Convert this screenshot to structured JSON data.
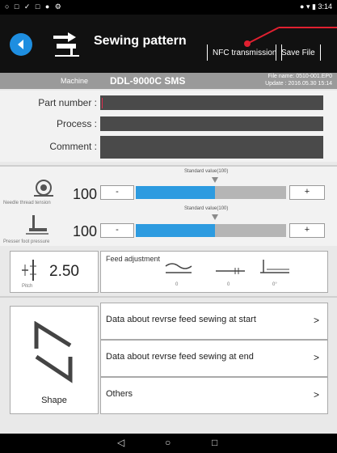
{
  "status_bar": {
    "icons_left": "○ □ ✓ □ ● ⚙",
    "time": "3:14"
  },
  "app_bar": {
    "title": "Sewing pattern",
    "nfc_label": "NFC transmission",
    "save_label": "Save File",
    "back_icon": "back-arrow-icon"
  },
  "machine_bar": {
    "label": "Machine",
    "name": "DDL-9000C SMS",
    "file_name": "File name: 0510-001.EP0",
    "update": "Update : 2016.05.30 15:14"
  },
  "form": {
    "part_number_label": "Part number :",
    "process_label": "Process :",
    "comment_label": "Comment :",
    "part_number_value": "",
    "process_value": "",
    "comment_value": ""
  },
  "needle_tension": {
    "caption": "Needle thread tension",
    "value": "100",
    "std_label": "Standard value(100)",
    "minus": "-",
    "plus": "+",
    "fill_fraction": 0.5
  },
  "presser_pressure": {
    "caption": "Presser foot pressure",
    "value": "100",
    "std_label": "Standard value(100)",
    "minus": "-",
    "plus": "+",
    "fill_fraction": 0.5
  },
  "pitch": {
    "value": "2.50",
    "caption": "Pitch"
  },
  "feed": {
    "title": "Feed adjustment",
    "val1": "0",
    "val2": "0",
    "val3": "0°"
  },
  "shape": {
    "label": "Shape"
  },
  "menu": [
    {
      "label": "Data about revrse feed sewing at start",
      "arrow": ">"
    },
    {
      "label": "Data about revrse feed sewing at end",
      "arrow": ">"
    },
    {
      "label": "Others",
      "arrow": ">"
    }
  ],
  "nav": {
    "back": "◁",
    "home": "○",
    "recent": "□"
  },
  "colors": {
    "accent": "#2d9be0",
    "red_annotation": "#e02030"
  }
}
